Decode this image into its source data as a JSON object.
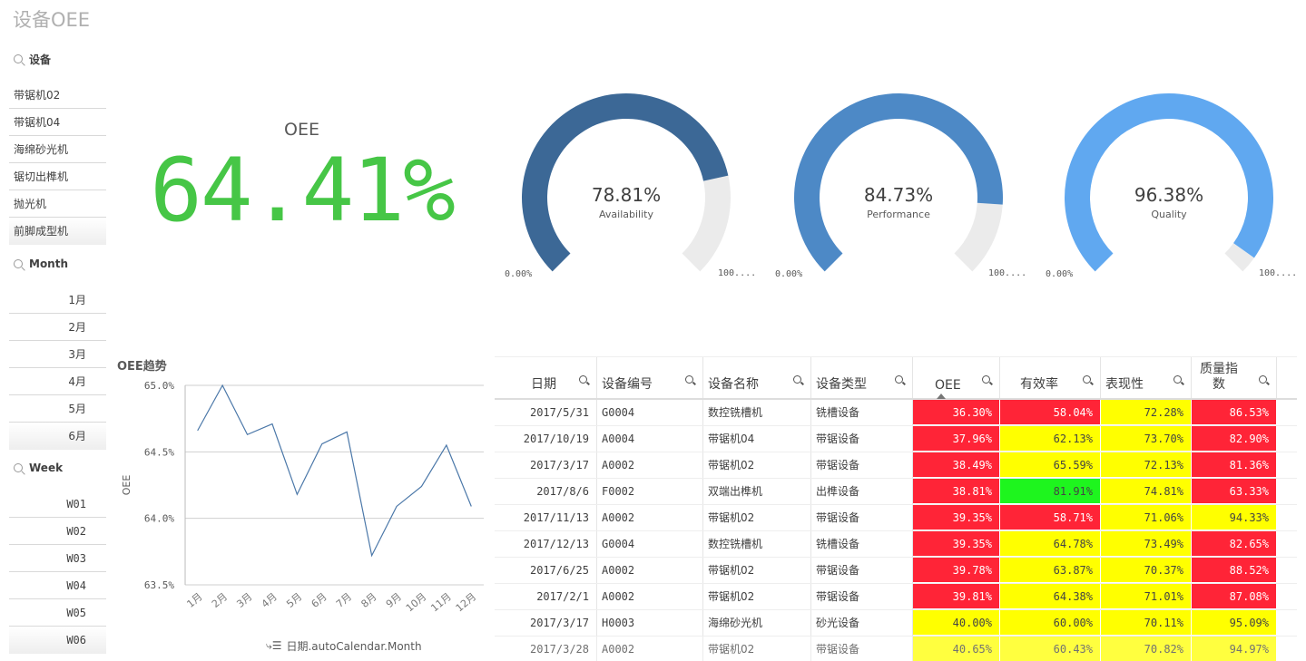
{
  "app": {
    "title": "设备OEE"
  },
  "filters": {
    "device": {
      "title": "设备",
      "items": [
        "带锯机02",
        "带锯机04",
        "海绵砂光机",
        "锯切出榫机",
        "抛光机",
        "前脚成型机"
      ]
    },
    "month": {
      "title": "Month",
      "items": [
        "1月",
        "2月",
        "3月",
        "4月",
        "5月",
        "6月"
      ]
    },
    "week": {
      "title": "Week",
      "items": [
        "W01",
        "W02",
        "W03",
        "W04",
        "W05",
        "W06"
      ]
    }
  },
  "kpi": {
    "label": "OEE",
    "value": "64.41%",
    "color": "#46c646"
  },
  "gauges": [
    {
      "value_text": "78.81%",
      "value": 0.7881,
      "label": "Availability",
      "min": "0.00%",
      "max": "100....",
      "color": "#3c6896"
    },
    {
      "value_text": "84.73%",
      "value": 0.8473,
      "label": "Performance",
      "min": "0.00%",
      "max": "100....",
      "color": "#4d89c6"
    },
    {
      "value_text": "96.38%",
      "value": 0.9638,
      "label": "Quality",
      "min": "0.00%",
      "max": "100....",
      "color": "#60a8f0"
    }
  ],
  "chart_data": {
    "type": "line",
    "title": "OEE趋势",
    "xlabel": "日期.autoCalendar.Month",
    "ylabel": "OEE",
    "categories": [
      "1月",
      "2月",
      "3月",
      "4月",
      "5月",
      "6月",
      "7月",
      "8月",
      "9月",
      "10月",
      "11月",
      "12月"
    ],
    "series": [
      {
        "name": "OEE",
        "values": [
          64.66,
          65.0,
          64.63,
          64.71,
          64.18,
          64.56,
          64.65,
          63.72,
          64.09,
          64.24,
          64.55,
          64.09
        ]
      }
    ],
    "ylim": [
      63.5,
      65.0
    ],
    "yticks": [
      "63.5%",
      "64.0%",
      "64.5%",
      "65.0%"
    ],
    "ytick_values": [
      63.5,
      64.0,
      64.5,
      65.0
    ],
    "grid": true,
    "line_color": "#4a77a8"
  },
  "table": {
    "headers": [
      "日期",
      "设备编号",
      "设备名称",
      "设备类型",
      "OEE",
      "有效率",
      "表现性",
      "质量指数"
    ],
    "rows": [
      {
        "cells": [
          "2017/5/31",
          "G0004",
          "数控铣槽机",
          "铣槽设备",
          "36.30%",
          "58.04%",
          "72.28%",
          "86.53%"
        ],
        "colors": [
          "red",
          "red",
          "yellow",
          "red"
        ]
      },
      {
        "cells": [
          "2017/10/19",
          "A0004",
          "带锯机04",
          "带锯设备",
          "37.96%",
          "62.13%",
          "73.70%",
          "82.90%"
        ],
        "colors": [
          "red",
          "yellow",
          "yellow",
          "red"
        ]
      },
      {
        "cells": [
          "2017/3/17",
          "A0002",
          "带锯机02",
          "带锯设备",
          "38.49%",
          "65.59%",
          "72.13%",
          "81.36%"
        ],
        "colors": [
          "red",
          "yellow",
          "yellow",
          "red"
        ]
      },
      {
        "cells": [
          "2017/8/6",
          "F0002",
          "双端出榫机",
          "出榫设备",
          "38.81%",
          "81.91%",
          "74.81%",
          "63.33%"
        ],
        "colors": [
          "red",
          "green",
          "yellow",
          "red"
        ]
      },
      {
        "cells": [
          "2017/11/13",
          "A0002",
          "带锯机02",
          "带锯设备",
          "39.35%",
          "58.71%",
          "71.06%",
          "94.33%"
        ],
        "colors": [
          "red",
          "red",
          "yellow",
          "yellow"
        ]
      },
      {
        "cells": [
          "2017/12/13",
          "G0004",
          "数控铣槽机",
          "铣槽设备",
          "39.35%",
          "64.78%",
          "73.49%",
          "82.65%"
        ],
        "colors": [
          "red",
          "yellow",
          "yellow",
          "red"
        ]
      },
      {
        "cells": [
          "2017/6/25",
          "A0002",
          "带锯机02",
          "带锯设备",
          "39.78%",
          "63.87%",
          "70.37%",
          "88.52%"
        ],
        "colors": [
          "red",
          "yellow",
          "yellow",
          "red"
        ]
      },
      {
        "cells": [
          "2017/2/1",
          "A0002",
          "带锯机02",
          "带锯设备",
          "39.81%",
          "64.38%",
          "71.01%",
          "87.08%"
        ],
        "colors": [
          "red",
          "yellow",
          "yellow",
          "red"
        ]
      },
      {
        "cells": [
          "2017/3/17",
          "H0003",
          "海绵砂光机",
          "砂光设备",
          "40.00%",
          "60.00%",
          "70.11%",
          "95.09%"
        ],
        "colors": [
          "yellow",
          "yellow",
          "yellow",
          "yellow"
        ]
      },
      {
        "cells": [
          "2017/3/28",
          "A0002",
          "带锯机02",
          "带锯设备",
          "40.65%",
          "60.43%",
          "70.82%",
          "94.97%"
        ],
        "colors": [
          "yellow",
          "yellow",
          "yellow",
          "yellow"
        ]
      }
    ]
  }
}
